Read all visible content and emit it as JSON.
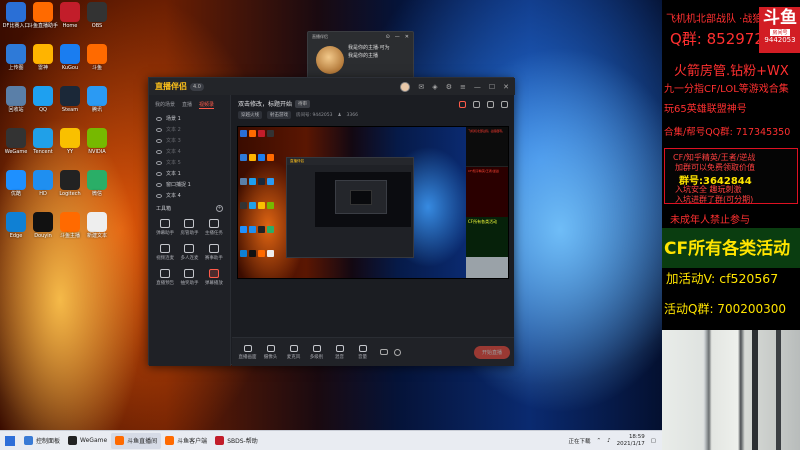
{
  "desktop": {
    "icons": [
      {
        "label": "DF比赛入口",
        "color": "#2a6fd6"
      },
      {
        "label": "斗鱼直播助手",
        "color": "#ff6a00"
      },
      {
        "label": "Home",
        "color": "#c21d2a"
      },
      {
        "label": "OBS",
        "color": "#333"
      },
      {
        "label": "上传图",
        "color": "#2e7ad8"
      },
      {
        "label": "雷神",
        "color": "#ffb400"
      },
      {
        "label": "KuGou",
        "color": "#1a7df0"
      },
      {
        "label": "斗鱼",
        "color": "#ff6a00"
      },
      {
        "label": "回收站",
        "color": "#5a7fa8"
      },
      {
        "label": "QQ",
        "color": "#1ea0f0"
      },
      {
        "label": "Steam",
        "color": "#1b2838"
      },
      {
        "label": "腾讯",
        "color": "#2b9af3"
      },
      {
        "label": "WeGame",
        "color": "#333"
      },
      {
        "label": "Tencent",
        "color": "#20a0e8"
      },
      {
        "label": "YY",
        "color": "#f9c000"
      },
      {
        "label": "NVIDIA",
        "color": "#76b900"
      },
      {
        "label": "优酷",
        "color": "#1e90ff"
      },
      {
        "label": "HD",
        "color": "#1f8ff0"
      },
      {
        "label": "Logitech",
        "color": "#222"
      },
      {
        "label": "微信",
        "color": "#2aae67"
      },
      {
        "label": "Edge",
        "color": "#0f80d4"
      },
      {
        "label": "Douyin",
        "color": "#111"
      },
      {
        "label": "斗鱼主播",
        "color": "#ff6a00"
      },
      {
        "label": "新建文本",
        "color": "#eee"
      }
    ]
  },
  "taskbar": {
    "items": [
      {
        "label": "控制面板",
        "color": "#3a7bd5"
      },
      {
        "label": "WeGame",
        "color": "#222"
      },
      {
        "label": "斗鱼直播间",
        "color": "#ff6a00"
      },
      {
        "label": "斗鱼客户端",
        "color": "#ff6a00"
      },
      {
        "label": "SBDS-帮助",
        "color": "#c21d2a"
      }
    ],
    "tray_text": "正在下载",
    "time": "18:59",
    "date": "2021/1/17"
  },
  "app": {
    "name": "直播伴侣",
    "badge": "4.0",
    "left_tabs": [
      "我的场景",
      "直播",
      "视频录"
    ],
    "scenes": [
      "场景 1",
      "文本 2",
      "文本 3",
      "文本 4",
      "文本 5",
      "文本 1",
      "窗口捕捉 1",
      "文本 4"
    ],
    "tools_title": "工具箱",
    "tools": [
      "弹幕助手",
      "房管助手",
      "主播任务",
      "视频连麦",
      "多人连麦",
      "赛事助手",
      "直播预告",
      "抽奖助手",
      "弹幕播放"
    ],
    "stream_title": "双击修改，标题开始",
    "stream_tag": "待审",
    "meta_chip1": "穿越火线",
    "meta_chip2": "射击游戏",
    "room_id": "房间号: 9442053",
    "viewers": "3366",
    "controls": [
      "直播画面",
      "摄像头",
      "麦克风",
      "多级别",
      "混音",
      "音量"
    ],
    "go_live": "开始直播"
  },
  "float_window": {
    "title": "直播伴侣",
    "line1": "我是你的主播·可为",
    "line2": "我是你的主播"
  },
  "overlay": {
    "line1": "飞机机北部战队 ·战狼部队",
    "qq1": "Q群: 852972",
    "logo_big": "斗鱼",
    "logo_small": "房间号",
    "logo_num": "9442053",
    "line3": "火箭房管.钻粉+WX",
    "line4": "九一分指CF/LOL等游戏合集",
    "line5": "玩65英雄联盟神号",
    "line6": "合集/帮号QQ群: 717345350",
    "box_line1": "CF/知乎精英/王者/逆战",
    "box_line2": "加群可以免费领取价值",
    "box_line3": "群号:3642844",
    "box_line4": "入坑安全 趣玩刺激",
    "box_line5": "入坑进群了群(可分期)",
    "warning": "未成年人禁止参与",
    "green_title": "CF所有各类活动",
    "contact1": "加活动V: cf520567",
    "contact2": "活动Q群: 700200300",
    "accent": "#ff2a2a",
    "yellow": "#ffe400"
  }
}
